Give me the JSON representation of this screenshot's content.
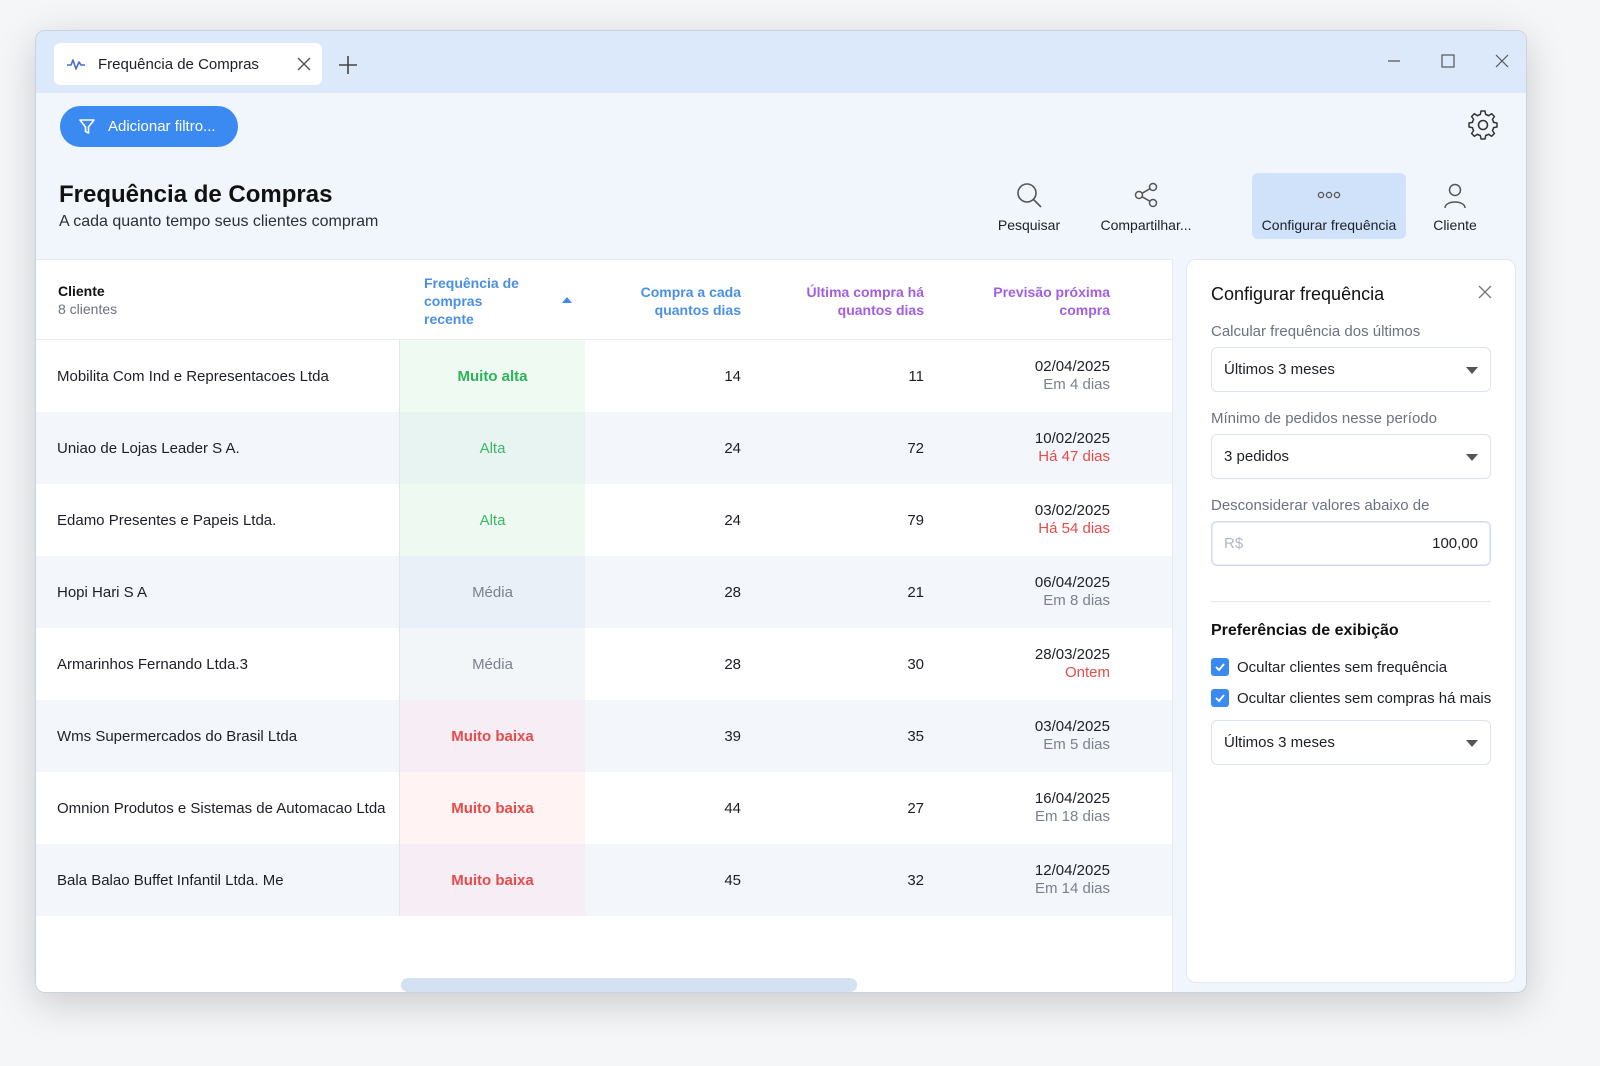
{
  "tab": {
    "title": "Frequência de Compras"
  },
  "toolbar": {
    "filter_label": "Adicionar filtro..."
  },
  "page": {
    "title": "Frequência de Compras",
    "subtitle": "A cada quanto tempo seus clientes compram"
  },
  "actions": [
    {
      "label": "Pesquisar",
      "icon": "search-icon"
    },
    {
      "label": "Compartilhar...",
      "icon": "share-icon"
    },
    {
      "label": "Configurar frequência",
      "icon": "dots-icon",
      "active": true
    },
    {
      "label": "Cliente",
      "icon": "user-icon"
    }
  ],
  "table": {
    "headers": {
      "client": "Cliente",
      "client_count": "8 clientes",
      "freq_l1": "Frequência de",
      "freq_l2": "compras",
      "freq_l3": "recente",
      "every_l1": "Compra a cada",
      "every_l2": "quantos dias",
      "last_l1": "Última compra há",
      "last_l2": "quantos dias",
      "next_l1": "Previsão próxima",
      "next_l2": "compra"
    },
    "rows": [
      {
        "client": "Mobilita Com Ind e Representacoes Ltda",
        "freq": "Muito alta",
        "freq_color": "#2fb35a",
        "freq_bg": "#eefaf2",
        "every": "14",
        "last": "11",
        "date": "02/04/2025",
        "rel": "Em 4 dias",
        "rel_type": "g"
      },
      {
        "client": "Uniao de Lojas Leader S A.",
        "freq": "Alta",
        "freq_color": "#3db867",
        "freq_bg": "#e8f4f1",
        "every": "24",
        "last": "72",
        "date": "10/02/2025",
        "rel": "Há 47 dias",
        "rel_type": "r"
      },
      {
        "client": "Edamo Presentes e Papeis Ltda.",
        "freq": "Alta",
        "freq_color": "#3db867",
        "freq_bg": "#eef9f2",
        "every": "24",
        "last": "79",
        "date": "03/02/2025",
        "rel": "Há 54 dias",
        "rel_type": "r"
      },
      {
        "client": "Hopi Hari S A",
        "freq": "Média",
        "freq_color": "#7a818c",
        "freq_bg": "#eaf0f8",
        "every": "28",
        "last": "21",
        "date": "06/04/2025",
        "rel": "Em 8 dias",
        "rel_type": "g"
      },
      {
        "client": "Armarinhos Fernando Ltda.3",
        "freq": "Média",
        "freq_color": "#7a818c",
        "freq_bg": "#f3f6f8",
        "every": "28",
        "last": "30",
        "date": "28/03/2025",
        "rel": "Ontem",
        "rel_type": "r"
      },
      {
        "client": "Wms Supermercados do Brasil Ltda",
        "freq": "Muito baixa",
        "freq_color": "#e84a4a",
        "freq_bg": "#f6eef4",
        "every": "39",
        "last": "35",
        "date": "03/04/2025",
        "rel": "Em 5 dias",
        "rel_type": "g"
      },
      {
        "client": "Omnion Produtos e Sistemas de Automacao Ltda",
        "freq": "Muito baixa",
        "freq_color": "#e84a4a",
        "freq_bg": "#fff3f3",
        "every": "44",
        "last": "27",
        "date": "16/04/2025",
        "rel": "Em 18 dias",
        "rel_type": "g"
      },
      {
        "client": "Bala Balao Buffet Infantil Ltda. Me",
        "freq": "Muito baixa",
        "freq_color": "#e84a4a",
        "freq_bg": "#f6eef4",
        "every": "45",
        "last": "32",
        "date": "12/04/2025",
        "rel": "Em 14 dias",
        "rel_type": "g"
      }
    ]
  },
  "panel": {
    "title": "Configurar frequência",
    "calc_label": "Calcular frequência dos últimos",
    "calc_value": "Últimos 3 meses",
    "min_label": "Mínimo de pedidos nesse período",
    "min_value": "3 pedidos",
    "ignore_label": "Desconsiderar valores abaixo de",
    "ignore_prefix": "R$",
    "ignore_value": "100,00",
    "prefs_title": "Preferências de exibição",
    "check1": "Ocultar clientes sem frequência",
    "check2": "Ocultar clientes sem compras há mais",
    "period_value": "Últimos 3 meses"
  },
  "colors": {
    "accent": "#3b8af2",
    "header_blue": "#4a90e2",
    "header_purple": "#a25ee0",
    "negative": "#e84a4a",
    "positive": "#2fb35a"
  }
}
